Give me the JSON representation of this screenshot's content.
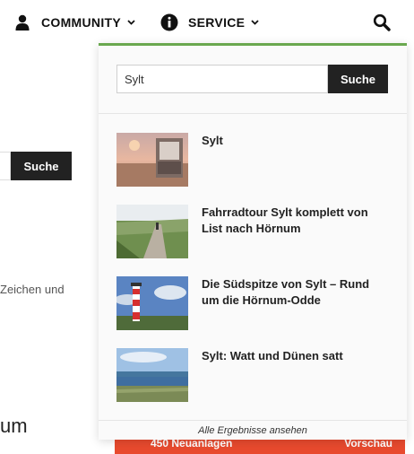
{
  "nav": {
    "community_label": "COMMUNITY",
    "service_label": "SERVICE",
    "community_icon": "user-icon",
    "service_icon": "info-icon",
    "search_icon": "search-icon"
  },
  "background": {
    "search_button_label": "Suche",
    "partial_text": "Zeichen und",
    "partial_heading": "um",
    "red_bar_left": "450 Neuanlagen",
    "red_bar_right": "Vorschau"
  },
  "search": {
    "query": "Sylt",
    "button_label": "Suche",
    "results": [
      {
        "title": "Sylt"
      },
      {
        "title": "Fahrradtour Sylt komplett von List nach Hörnum"
      },
      {
        "title": "Die Südspitze von Sylt – Rund um die Hörnum-Odde"
      },
      {
        "title": "Sylt: Watt und Dünen satt"
      }
    ],
    "all_results_label": "Alle Ergebnisse ansehen"
  },
  "colors": {
    "accent_green": "#6aa84f",
    "button_dark": "#222222",
    "alert_red": "#e84a2e"
  }
}
